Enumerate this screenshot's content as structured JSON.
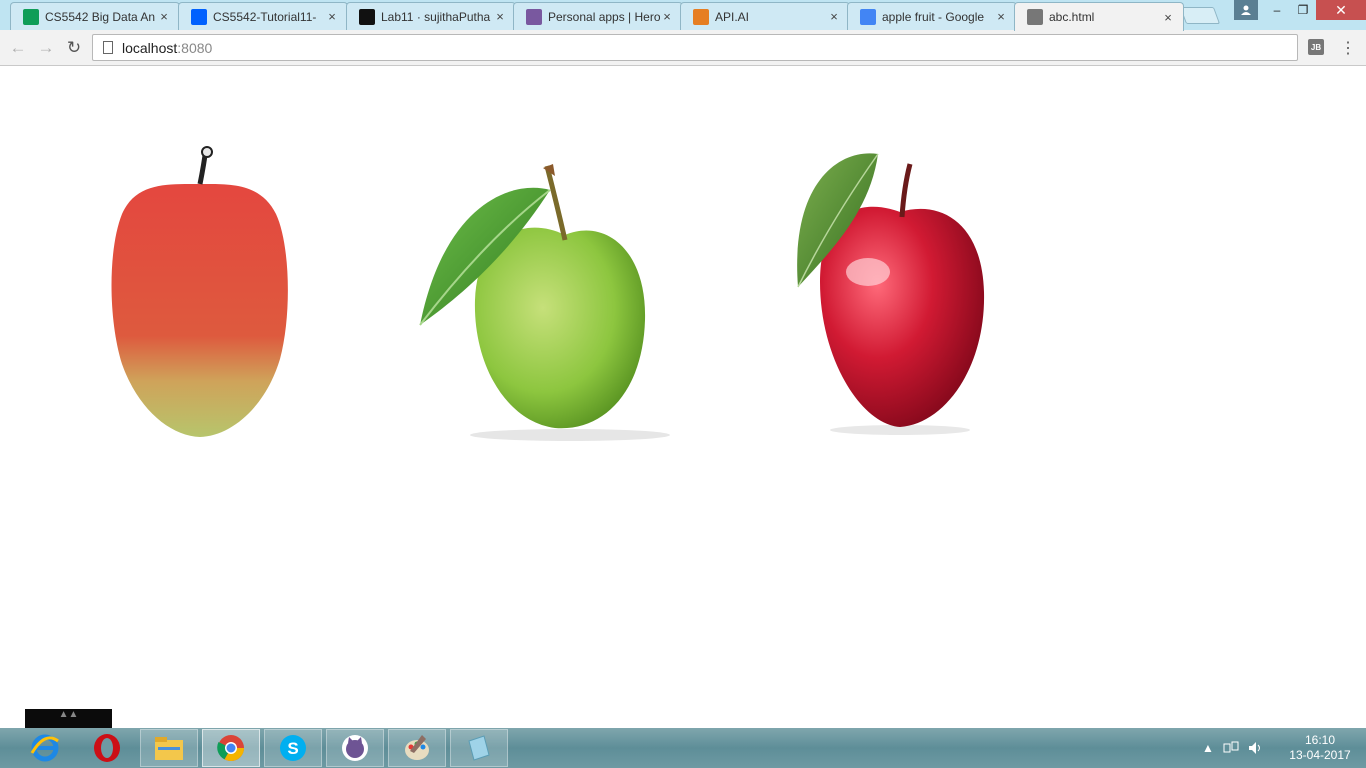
{
  "browser": {
    "tabs": [
      {
        "title": "CS5542 Big Data An",
        "icon": "sheets-icon",
        "color": "#0f9d58"
      },
      {
        "title": "CS5542-Tutorial11-",
        "icon": "dropbox-icon",
        "color": "#0061fe"
      },
      {
        "title": "Lab11 · sujithaPutha",
        "icon": "github-icon",
        "color": "#111111"
      },
      {
        "title": "Personal apps | Hero",
        "icon": "heroku-icon",
        "color": "#79589f"
      },
      {
        "title": "API.AI",
        "icon": "apiai-icon",
        "color": "#e67e22"
      },
      {
        "title": "apple fruit - Google",
        "icon": "google-icon",
        "color": "#4285f4"
      },
      {
        "title": "abc.html",
        "icon": "page-icon",
        "color": "#777777",
        "active": true
      }
    ],
    "close_glyph": "×",
    "window": {
      "minimize": "–",
      "maximize": "❐",
      "close": "✕"
    },
    "url_host": "localhost",
    "url_port": ":8080",
    "extension_label": "JB",
    "menu_glyph": "⋮",
    "back_glyph": "←",
    "forward_glyph": "→",
    "reload_glyph": "↻"
  },
  "page": {
    "images": [
      {
        "name": "pink-apple",
        "colors": {
          "top": "#e0453f",
          "bottom": "#b8c76a"
        }
      },
      {
        "name": "green-apple",
        "colors": {
          "body": "#8dc63f",
          "leaf": "#3f8f2f"
        }
      },
      {
        "name": "red-apple",
        "colors": {
          "body": "#c8102e",
          "leaf": "#4a8c2a"
        }
      }
    ]
  },
  "taskbar": {
    "apps": [
      "internet-explorer-icon",
      "opera-icon",
      "file-explorer-icon",
      "chrome-icon",
      "skype-icon",
      "github-desktop-icon",
      "paint-icon",
      "notes-icon"
    ],
    "time": "16:10",
    "date": "13-04-2017"
  }
}
